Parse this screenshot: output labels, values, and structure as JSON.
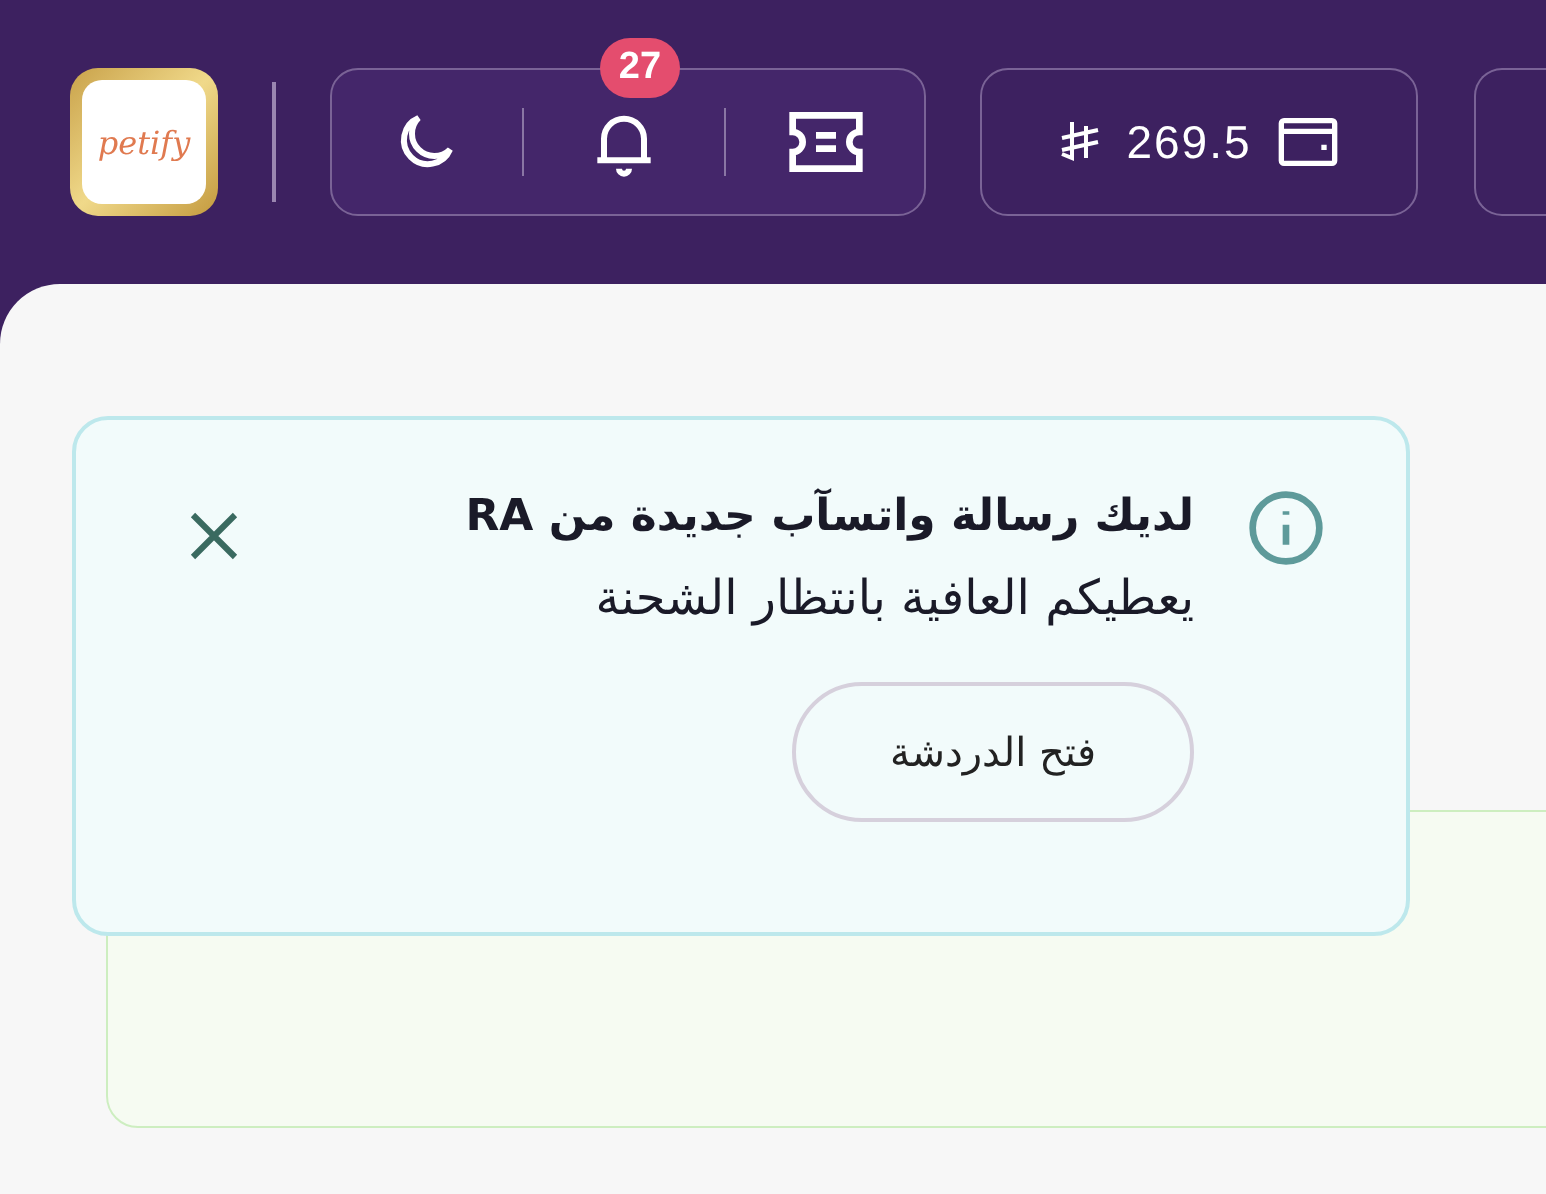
{
  "header": {
    "logo": {
      "text": "petify"
    },
    "notifications": {
      "badge": "27"
    },
    "wallet": {
      "balance": "269.5"
    }
  },
  "alert": {
    "title": "لديك رسالة واتسآب جديدة من RA",
    "message": "يعطيكم العافية بانتظار الشحنة",
    "action": "فتح الدردشة"
  }
}
